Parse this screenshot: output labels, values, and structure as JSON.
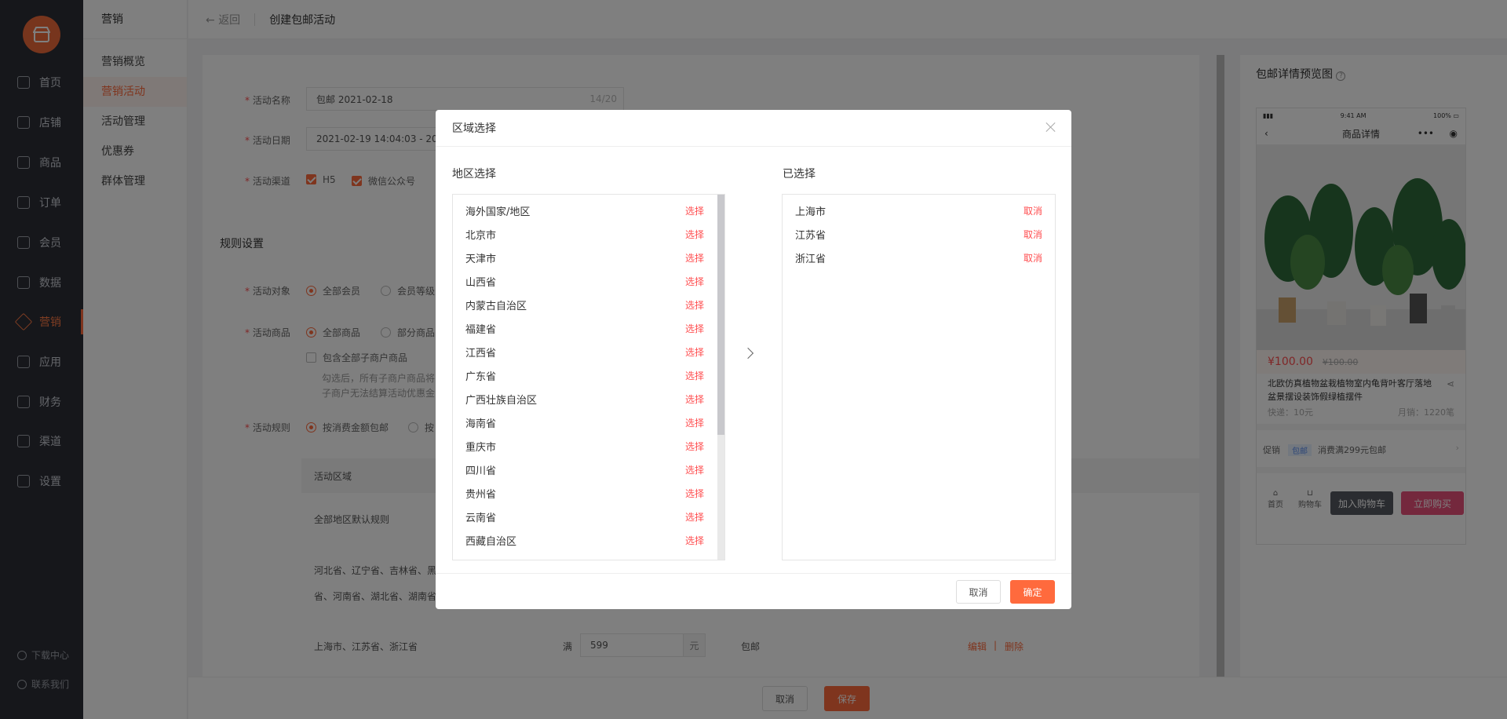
{
  "sidebar": {
    "items": [
      {
        "label": "首页",
        "icon": "home-icon"
      },
      {
        "label": "店铺",
        "icon": "store-icon"
      },
      {
        "label": "商品",
        "icon": "goods-icon"
      },
      {
        "label": "订单",
        "icon": "order-icon"
      },
      {
        "label": "会员",
        "icon": "member-icon"
      },
      {
        "label": "数据",
        "icon": "data-icon"
      },
      {
        "label": "营销",
        "icon": "marketing-icon"
      },
      {
        "label": "应用",
        "icon": "apps-icon"
      },
      {
        "label": "财务",
        "icon": "finance-icon"
      },
      {
        "label": "渠道",
        "icon": "channel-icon"
      },
      {
        "label": "设置",
        "icon": "settings-icon"
      }
    ],
    "active": "营销",
    "download": "下载中心",
    "contact": "联系我们"
  },
  "subnav": {
    "title": "营销",
    "items": [
      "营销概览",
      "营销活动",
      "活动管理",
      "优惠券",
      "群体管理"
    ],
    "active": "营销活动"
  },
  "topbar": {
    "back": "返回",
    "title": "创建包邮活动"
  },
  "form": {
    "name_label": "活动名称",
    "name_value": "包邮  2021-02-18",
    "name_count": "14/20",
    "date_label": "活动日期",
    "date_value": "2021-02-19 14:04:03 - 20",
    "channel_label": "活动渠道",
    "channel_h5": "H5",
    "channel_wechat": "微信公众号",
    "rule_section": "规则设置",
    "target_label": "活动对象",
    "target_all": "全部会员",
    "target_level": "会员等级",
    "goods_label": "活动商品",
    "goods_all": "全部商品",
    "goods_part": "部分商品",
    "include_sub": "包含全部子商户商品",
    "hint_1": "勾选后，所有子商户商品将",
    "hint_2": "子商户无法结算活动优惠金",
    "rule_label": "活动规则",
    "rule_amount": "按消费金额包邮",
    "rule_other": "按",
    "table_head": "活动区域",
    "default_rule": "全部地区默认规则",
    "region_line_1": "河北省、辽宁省、吉林省、黑",
    "region_line_2": "省、河南省、湖北省、湖南省",
    "row_regions": "上海市、江苏省、浙江省",
    "row_full": "满",
    "row_amount": "599",
    "row_unit": "元",
    "row_free": "包邮",
    "row_edit": "编辑",
    "row_divider": "|",
    "row_delete": "删除"
  },
  "preview": {
    "title": "包邮详情预览图",
    "status_time": "9:41 AM",
    "status_battery": "100%",
    "page_title": "商品详情",
    "price": "¥100.00",
    "original_price": "¥100.00",
    "product_name": "北欧仿真植物盆栽植物室内龟背叶客厅落地盆景摆设装饰假绿植摆件",
    "shipping": "快递：10元",
    "monthly_sales": "月销：1220笔",
    "promo_label": "促销",
    "promo_tag": "包邮",
    "promo_text": "消费满299元包邮",
    "bottom_home": "首页",
    "bottom_cart": "购物车",
    "add_cart": "加入购物车",
    "buy_now": "立即购买"
  },
  "footer": {
    "cancel": "取消",
    "save": "保存"
  },
  "modal": {
    "title": "区域选择",
    "left_title": "地区选择",
    "right_title": "已选择",
    "select_action": "选择",
    "cancel_action": "取消",
    "available": [
      "海外国家/地区",
      "北京市",
      "天津市",
      "山西省",
      "内蒙古自治区",
      "福建省",
      "江西省",
      "广东省",
      "广西壮族自治区",
      "海南省",
      "重庆市",
      "四川省",
      "贵州省",
      "云南省",
      "西藏自治区"
    ],
    "selected": [
      "上海市",
      "江苏省",
      "浙江省"
    ],
    "cancel_button": "取消",
    "confirm_button": "确定"
  },
  "colors": {
    "accent": "#ff6a3d",
    "sidebar": "#2c2e36",
    "danger": "#ff4d4f"
  }
}
